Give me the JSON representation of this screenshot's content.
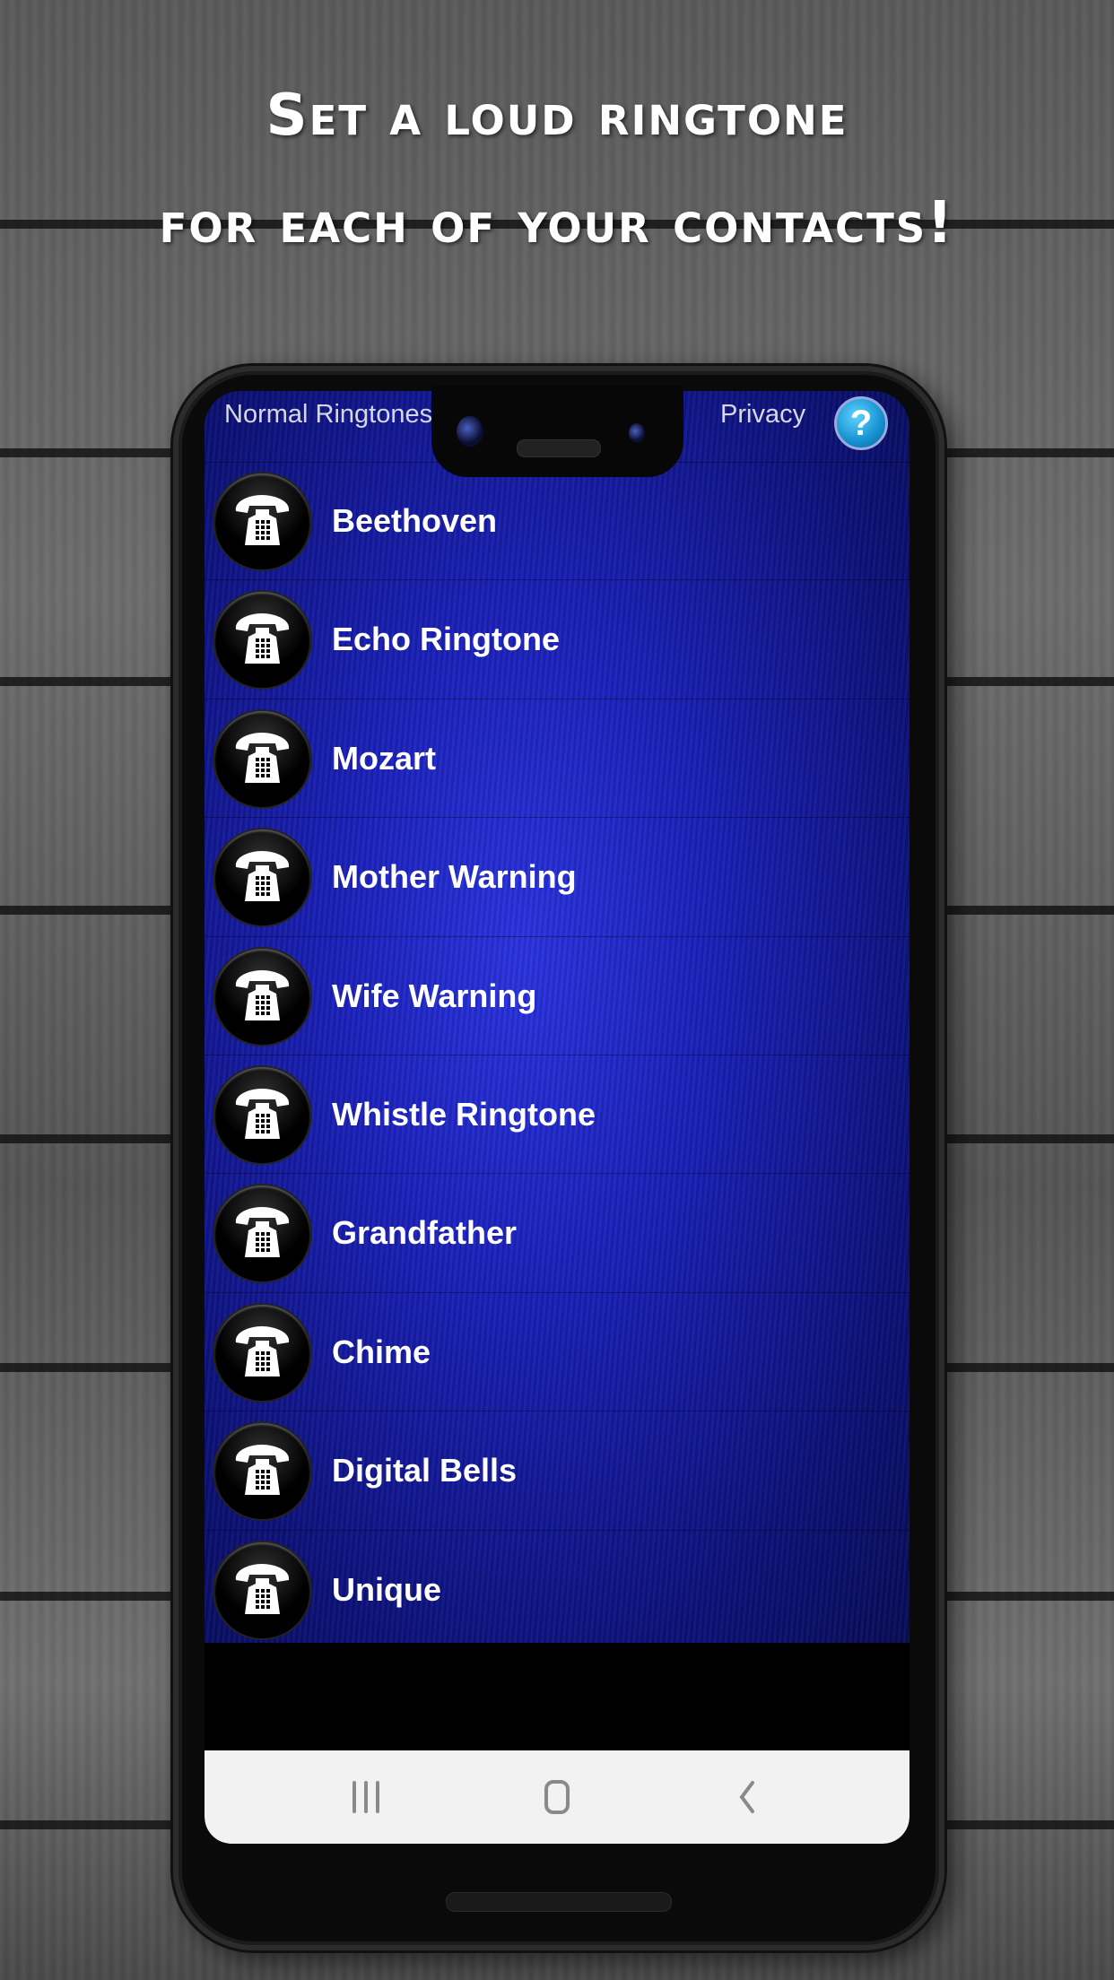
{
  "headline": {
    "line1": "Set a loud ringtone",
    "line2": "for each of your contacts!"
  },
  "topbar": {
    "tab_normal": "Normal Ringtones",
    "tab_privacy": "Privacy",
    "help_icon": "question-mark-icon",
    "help_glyph": "?"
  },
  "ringtones": [
    {
      "label": "Beethoven",
      "icon": "telephone-icon"
    },
    {
      "label": "Echo Ringtone",
      "icon": "telephone-icon"
    },
    {
      "label": "Mozart",
      "icon": "telephone-icon"
    },
    {
      "label": "Mother Warning",
      "icon": "telephone-icon"
    },
    {
      "label": "Wife Warning",
      "icon": "telephone-icon"
    },
    {
      "label": "Whistle Ringtone",
      "icon": "telephone-icon"
    },
    {
      "label": "Grandfather",
      "icon": "telephone-icon"
    },
    {
      "label": "Chime",
      "icon": "telephone-icon"
    },
    {
      "label": "Digital Bells",
      "icon": "telephone-icon"
    },
    {
      "label": "Unique",
      "icon": "telephone-icon"
    }
  ],
  "navbar": {
    "items": [
      "recent-apps-icon",
      "home-icon",
      "back-icon"
    ]
  },
  "colors": {
    "app_background": "#1a20b8",
    "navbar": "#f2f2f2",
    "help_button": "#1590d0"
  }
}
